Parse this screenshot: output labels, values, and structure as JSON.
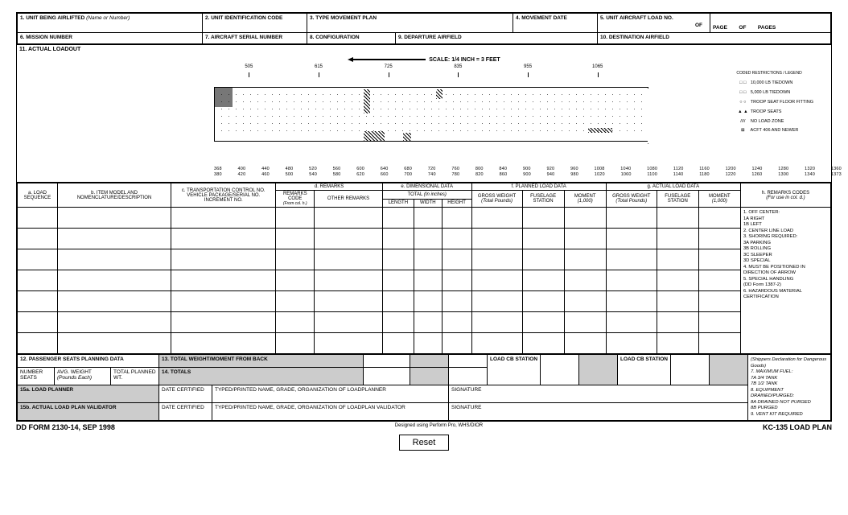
{
  "header": {
    "f1": "1.  UNIT BEING AIRLIFTED",
    "f1_hint": "(Name or Number)",
    "f2": "2.  UNIT IDENTIFICATION CODE",
    "f3": "3.  TYPE MOVEMENT PLAN",
    "f4": "4.  MOVEMENT DATE",
    "f5": "5.  UNIT AIRCRAFT LOAD NO.",
    "of": "OF",
    "page": "PAGE",
    "of2": "OF",
    "pages": "PAGES",
    "f6": "6.  MISSION NUMBER",
    "f7": "7.  AIRCRAFT SERIAL NUMBER",
    "f8": "8.  CONFIGURATION",
    "f9": "9.  DEPARTURE AIRFIELD",
    "f10": "10. DESTINATION AIRFIELD",
    "f11": "11. ACTUAL LOADOUT",
    "scale": "SCALE:  1/4 INCH  =  3 FEET"
  },
  "top_ticks": [
    "505",
    "615",
    "725",
    "835",
    "955",
    "1065"
  ],
  "bot_ticks_a": [
    "368",
    "400",
    "440",
    "480",
    "520",
    "560",
    "600",
    "640",
    "680",
    "720",
    "760",
    "800",
    "840",
    "900",
    "920",
    "960",
    "1008",
    "1040",
    "1080",
    "1120",
    "1160",
    "1200",
    "1240",
    "1280",
    "1320",
    "1360"
  ],
  "bot_ticks_b": [
    "380",
    "420",
    "460",
    "500",
    "540",
    "580",
    "620",
    "660",
    "700",
    "740",
    "780",
    "820",
    "860",
    "900",
    "940",
    "980",
    "1020",
    "1060",
    "1100",
    "1140",
    "1180",
    "1220",
    "1260",
    "1300",
    "1340",
    "1373"
  ],
  "legend": {
    "title": "CODED RESTRICTIONS / LEGEND",
    "items": [
      {
        "sym": "□ □",
        "txt": "10,000 LB TIEDOWN"
      },
      {
        "sym": "□ □",
        "txt": "5,000 LB TIEDOWN"
      },
      {
        "sym": "○ ○",
        "txt": "TROOP SEAT FLOOR FITTING"
      },
      {
        "sym": "▲ ▲",
        "txt": "TROOP SEATS"
      },
      {
        "sym": "////",
        "txt": "NO LOAD ZONE"
      },
      {
        "sym": "⊠",
        "txt": "ACFT 406 AND NEWER"
      }
    ]
  },
  "cols": {
    "a": "a. LOAD SEQUENCE",
    "b": "b. ITEM MODEL AND NOMENCLATURE/DESCRIPTION",
    "c": "c. TRANSPORTATION CONTROL NO. VEHICLE PACKAGE/SERIAL NO. INCREMENT NO.",
    "d": "d. REMARKS",
    "d1": "REMARKS CODE",
    "d1_hint": "(From col. h.)",
    "d2": "OTHER REMARKS",
    "e": "e. DIMENSIONAL DATA",
    "e_total": "TOTAL",
    "e_total_hint": "(In inches)",
    "e1": "LENGTH",
    "e2": "WIDTH",
    "e3": "HEIGHT",
    "f": "f. PLANNED LOAD DATA",
    "f1": "GROSS WEIGHT",
    "f1_hint": "(Total Pounds)",
    "f2": "FUSELAGE STATION",
    "f3": "MOMENT",
    "f3_hint": "(1,000)",
    "g": "g. ACTUAL LOAD DATA",
    "g1": "GROSS WEIGHT",
    "g1_hint": "(Total Pounds)",
    "g2": "FUSELAGE STATION",
    "g3": "MOMENT",
    "g3_hint": "(1,000)",
    "h": "h. REMARKS CODES",
    "h_hint": "(For use in col. d.)"
  },
  "remarks_codes": "1. OFF CENTER:\n  1A  RIGHT\n  1B  LEFT\n2. CENTER LINE LOAD\n3. SHORING REQUIRED:\n  3A  PARKING\n  3B  ROLLING\n  3C  SLEEPER\n  3D  SPECIAL\n4. MUST BE POSITIONED IN DIRECTION OF ARROW\n5. SPECIAL HANDLING\n(DD Form 1387-2)\n6. HAZARDOUS MATERIAL CERTIFICATION\n(Shippers Declaration for Dangerous Goods)\n7. MAXIMUM FUEL:\n  7A  3/4 TANK\n  7B  1/2 TANK\n8. EQUIPMENT DRAINED/PURGED:\n  8A  DRAINED NOT PURGED\n  8B  PURGED\n9. VENT KIT REQUIRED",
  "bottom": {
    "f12": "12. PASSENGER SEATS PLANNING DATA",
    "f12a": "NUMBER SEATS",
    "f12b": "AVG. WEIGHT",
    "f12b_hint": "(Pounds Each)",
    "f12c": "TOTAL PLANNED WT.",
    "f13": "13. TOTAL WEIGHT/MOMENT FROM BACK",
    "f14": "14. TOTALS",
    "loadcb": "LOAD CB STATION",
    "f15a": "15a. LOAD PLANNER",
    "f15b": "15b. ACTUAL LOAD PLAN VALIDATOR",
    "datecert": "DATE CERTIFIED",
    "typed_a": "TYPED/PRINTED NAME, GRADE, ORGANIZATION OF LOADPLANNER",
    "typed_b": "TYPED/PRINTED NAME, GRADE, ORGANIZATION OF LOADPLAN VALIDATOR",
    "sig": "SIGNATURE"
  },
  "footer": {
    "left": "DD FORM 2130-14, SEP 1998",
    "mid": "Designed using Perform Pro, WHS/DIOR",
    "right": "KC-135 LOAD PLAN",
    "reset": "Reset"
  }
}
